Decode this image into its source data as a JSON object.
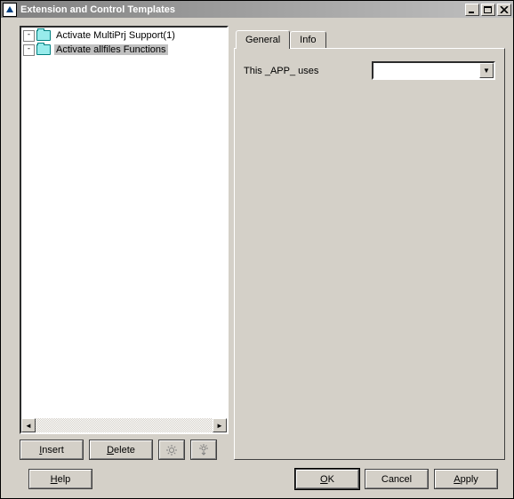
{
  "title": "Extension and Control Templates",
  "tree": {
    "items": [
      {
        "label": "Activate MultiPrj Support(1)",
        "selected": false
      },
      {
        "label": "Activate allfiles Functions",
        "selected": true
      }
    ]
  },
  "left_buttons": {
    "insert": "Insert",
    "delete": "Delete"
  },
  "tabs": {
    "general": "General",
    "info": "Info",
    "active": "general"
  },
  "form": {
    "this_app_uses_label": "This _APP_ uses",
    "this_app_uses_value": ""
  },
  "bottom": {
    "help": "Help",
    "ok": "OK",
    "cancel": "Cancel",
    "apply": "Apply"
  }
}
